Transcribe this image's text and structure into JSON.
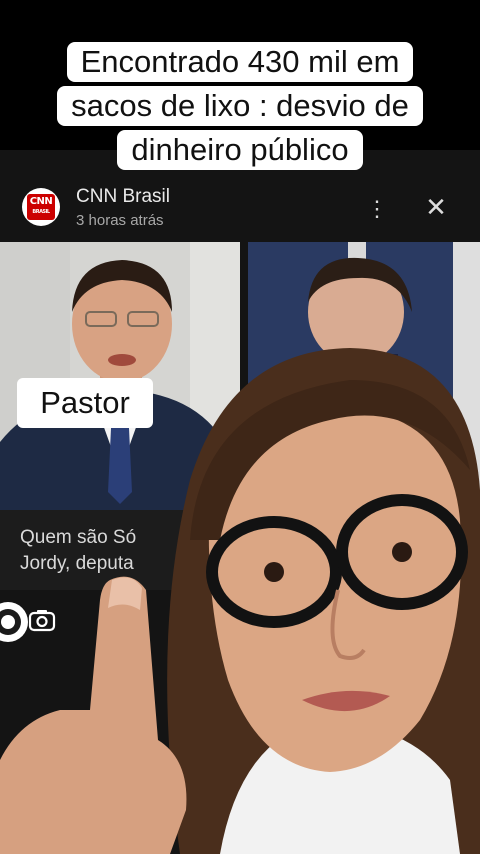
{
  "overlay": {
    "title_lines": [
      "Encontrado 430 mil em",
      "sacos de lixo : desvio de",
      "dinheiro público"
    ],
    "pastor_label": "Pastor"
  },
  "card": {
    "logo_text": "CNN",
    "logo_sub": "BRASIL",
    "source_name": "CNN Brasil",
    "timestamp": "3 horas atrás",
    "more_icon": "more-vert-icon",
    "close_icon": "close-icon",
    "caption_lines": [
      "Quem são Só",
      "Jordy, deputa"
    ]
  },
  "colors": {
    "logo_red": "#cc0000",
    "card_bg": "#141414",
    "label_bg": "#ffffff"
  }
}
